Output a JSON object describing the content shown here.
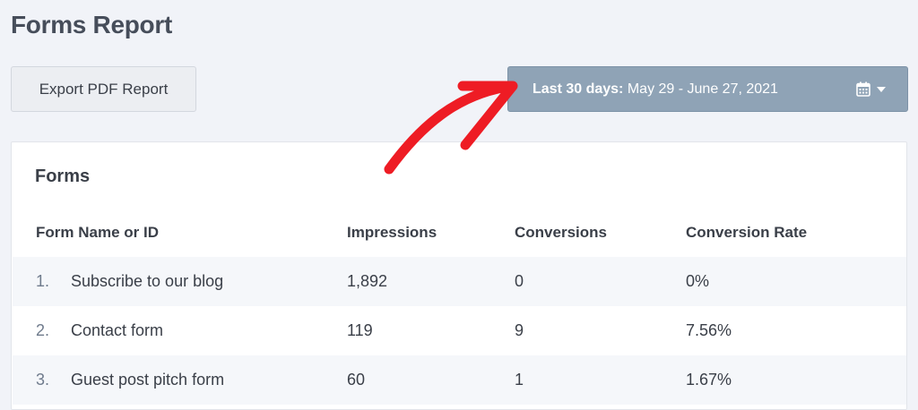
{
  "page": {
    "title": "Forms Report"
  },
  "toolbar": {
    "export_label": "Export PDF Report",
    "date_range": {
      "label": "Last 30 days:",
      "range": "May 29 - June 27, 2021",
      "icon": "calendar-icon"
    }
  },
  "annotation": {
    "color": "#ee1c24"
  },
  "card": {
    "title": "Forms",
    "columns": [
      "Form Name or ID",
      "Impressions",
      "Conversions",
      "Conversion Rate"
    ],
    "rows": [
      {
        "num": "1.",
        "name": "Subscribe to our blog",
        "impressions": "1,892",
        "conversions": "0",
        "rate": "0%"
      },
      {
        "num": "2.",
        "name": "Contact form",
        "impressions": "119",
        "conversions": "9",
        "rate": "7.56%"
      },
      {
        "num": "3.",
        "name": "Guest post pitch form",
        "impressions": "60",
        "conversions": "1",
        "rate": "1.67%"
      }
    ]
  }
}
